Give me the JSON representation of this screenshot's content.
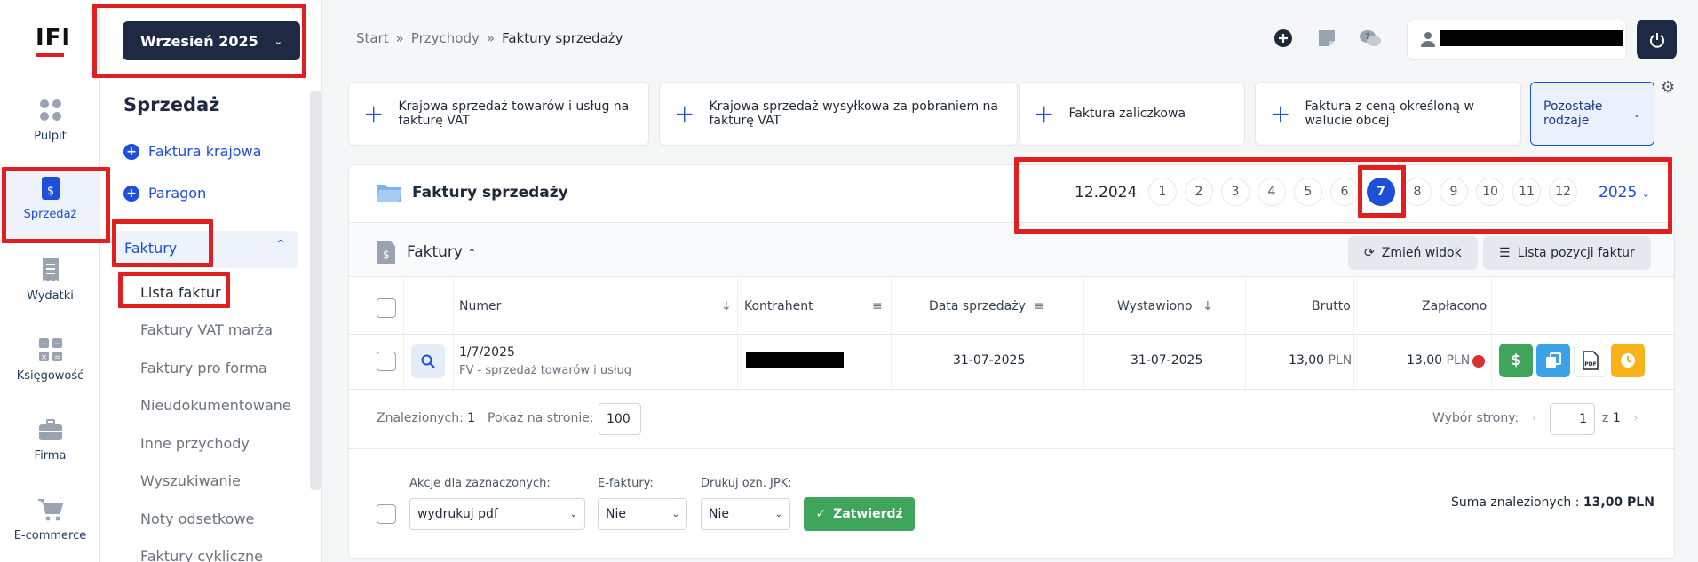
{
  "app": {
    "logo": "IFI",
    "month": "Wrzesień 2025"
  },
  "rail": [
    {
      "label": "Pulpit",
      "icon": "dashboard-icon"
    },
    {
      "label": "Sprzedaż",
      "icon": "invoice-dollar-icon"
    },
    {
      "label": "Wydatki",
      "icon": "receipt-icon"
    },
    {
      "label": "Księgowość",
      "icon": "calculator-icon"
    },
    {
      "label": "Firma",
      "icon": "briefcase-icon"
    },
    {
      "label": "E-commerce",
      "icon": "cart-icon"
    }
  ],
  "sidebar": {
    "title": "Sprzedaż",
    "links": [
      "Faktura krajowa",
      "Paragon"
    ],
    "group": "Faktury",
    "items": [
      "Lista faktur",
      "Faktury VAT marża",
      "Faktury pro forma",
      "Nieudokumentowane",
      "Inne przychody",
      "Wyszukiwanie",
      "Noty odsetkowe",
      "Faktury cykliczne"
    ]
  },
  "breadcrumb": [
    "Start",
    "Przychody",
    "Faktury sprzedaży"
  ],
  "quick_actions": [
    "Krajowa sprzedaż towarów i usług na fakturę VAT",
    "Krajowa sprzedaż wysyłkowa za pobraniem na fakturę VAT",
    "Faktura zaliczkowa",
    "Faktura z ceną określoną w walucie obcej"
  ],
  "more_types": "Pozostałe rodzaje",
  "panel": {
    "title": "Faktury sprzedaży",
    "period": "12.2024",
    "months": [
      "1",
      "2",
      "3",
      "4",
      "5",
      "6",
      "7",
      "8",
      "9",
      "10",
      "11",
      "12"
    ],
    "selected_month": "7",
    "year": "2025",
    "section": "Faktury",
    "change_view": "Zmień widok",
    "positions_list": "Lista pozycji faktur"
  },
  "table": {
    "headers": {
      "number": "Numer",
      "contractor": "Kontrahent",
      "sale_date": "Data sprzedaży",
      "issued": "Wystawiono",
      "gross": "Brutto",
      "paid": "Zapłacono"
    },
    "rows": [
      {
        "number": "1/7/2025",
        "type": "FV - sprzedaż towarów i usług",
        "sale_date": "31-07-2025",
        "issued": "31-07-2025",
        "gross": "13,00",
        "gross_cur": "PLN",
        "paid": "13,00",
        "paid_cur": "PLN"
      }
    ]
  },
  "footer": {
    "found_label": "Znalezionych:",
    "found": "1",
    "per_page_label": "Pokaż na stronie:",
    "per_page": "100",
    "page_label": "Wybór strony:",
    "page": "1",
    "of": "z",
    "pages": "1",
    "actions_label": "Akcje dla zaznaczonych:",
    "action": "wydrukuj pdf",
    "efaktury_label": "E-faktury:",
    "efaktury": "Nie",
    "jpk_label": "Drukuj ozn. JPK:",
    "jpk": "Nie",
    "confirm": "Zatwierdź",
    "sum_label": "Suma znalezionych :",
    "sum": "13,00 PLN"
  }
}
